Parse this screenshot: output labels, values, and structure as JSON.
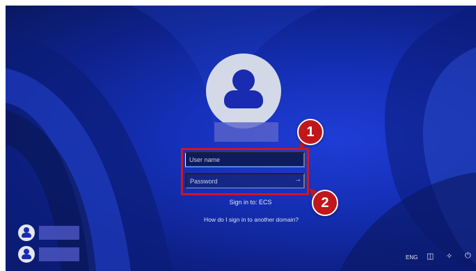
{
  "login": {
    "username_placeholder": "User name",
    "password_placeholder": "Password",
    "submit_icon": "arrow-right-icon",
    "sign_in_to": "Sign in to: ECS",
    "other_domain_link": "How do I sign in to another domain?"
  },
  "callouts": {
    "first": "1",
    "second": "2"
  },
  "taskbar": {
    "language": "ENG",
    "network_icon": "network-icon",
    "accessibility_icon": "accessibility-icon",
    "power_icon": "power-icon"
  },
  "colors": {
    "background": "#1530b8",
    "highlight": "#d4141c",
    "callout": "#c0171c",
    "field_underline": "#4c8ae6"
  }
}
